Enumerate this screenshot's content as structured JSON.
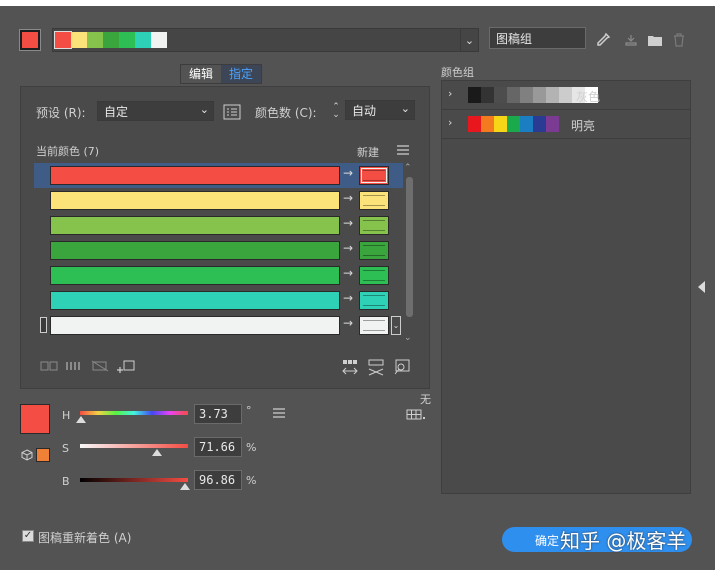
{
  "header": {
    "current_color": "#f44d43",
    "harmony_colors": [
      "#f44d43",
      "#fbe37a",
      "#86c34d",
      "#3aa53d",
      "#2dbf54",
      "#2ed1b5",
      "#f0f3f1"
    ],
    "artwork_group_name": "图稿组",
    "icons": [
      "eyedropper-icon",
      "save-group-icon",
      "folder-icon",
      "trash-icon"
    ]
  },
  "tabs": {
    "edit": "编辑",
    "assign": "指定"
  },
  "preset": {
    "label": "预设 (R):",
    "value": "自定"
  },
  "color_count": {
    "label": "颜色数 (C):",
    "value": "自动"
  },
  "list_header": {
    "current": "当前颜色 (7)",
    "new": "新建"
  },
  "color_rows": [
    {
      "current": "#f44d43",
      "new": "#f44d43",
      "selected": true
    },
    {
      "current": "#fbe37a",
      "new": "#fbe37a",
      "selected": false
    },
    {
      "current": "#86c34d",
      "new": "#86c34d",
      "selected": false
    },
    {
      "current": "#3aa53d",
      "new": "#3aa53d",
      "selected": false
    },
    {
      "current": "#2dbf54",
      "new": "#2dbf54",
      "selected": false
    },
    {
      "current": "#2ed1b5",
      "new": "#2ed1b5",
      "selected": false
    },
    {
      "current": "#f0f3f1",
      "new": "#f0f3f1",
      "selected": false
    }
  ],
  "sliders": {
    "h": {
      "label": "H",
      "value": "3.73",
      "unit": "°"
    },
    "s": {
      "label": "S",
      "value": "71.66",
      "unit": "%"
    },
    "b": {
      "label": "B",
      "value": "96.86",
      "unit": "%"
    }
  },
  "no_label": "无",
  "color_groups": {
    "title": "颜色组",
    "groups": [
      {
        "name": "灰色",
        "colors": [
          "#1a1a1a",
          "#333333",
          "#4d4d4d",
          "#666666",
          "#808080",
          "#999999",
          "#b3b3b3",
          "#cccccc",
          "#e6e6e6",
          "#ffffff"
        ]
      },
      {
        "name": "明亮",
        "colors": [
          "#e8161d",
          "#f37a1f",
          "#f7d517",
          "#1aa94b",
          "#1b7ec2",
          "#2a3b93",
          "#7b3b92"
        ]
      }
    ]
  },
  "footer": {
    "recolor_label": "图稿重新着色 (A)",
    "ok_label": "确定",
    "watermark": "知乎 @极客羊"
  }
}
